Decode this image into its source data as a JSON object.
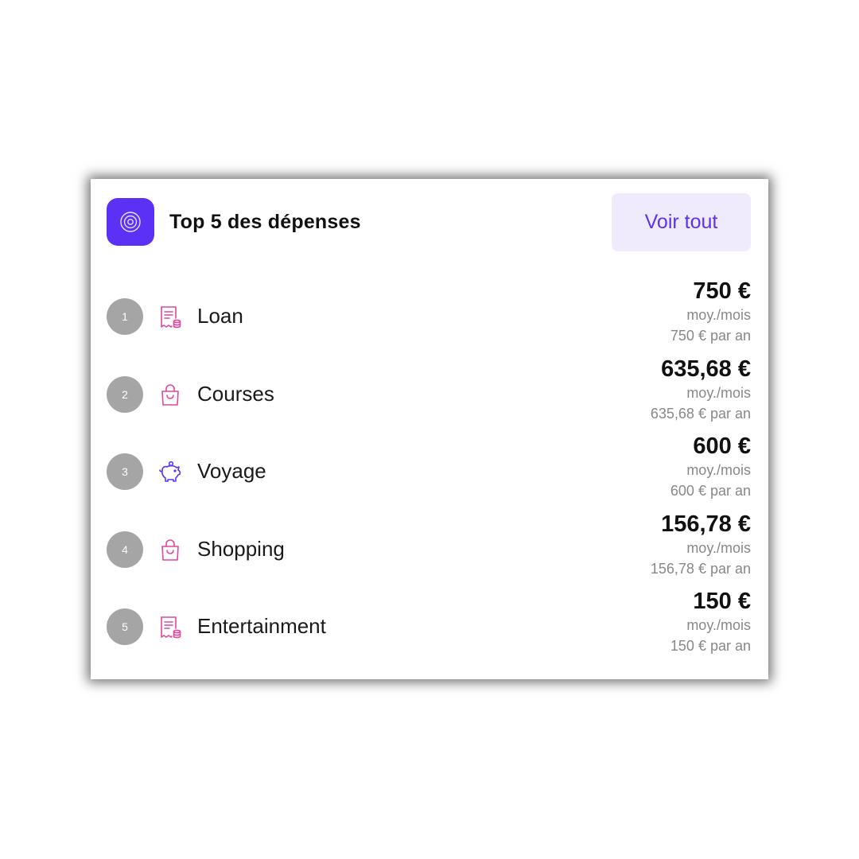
{
  "header": {
    "title": "Top 5 des dépenses",
    "icon": "target-icon",
    "see_all_label": "Voir tout",
    "accent_color": "#5b32f5"
  },
  "items": [
    {
      "rank": "1",
      "label": "Loan",
      "icon": "receipt-icon",
      "icon_color": "#e0479e",
      "amount": "750 €",
      "per_month": "moy./mois",
      "per_year": "750 € par an"
    },
    {
      "rank": "2",
      "label": "Courses",
      "icon": "shopping-bag-icon",
      "icon_color": "#e0479e",
      "amount": "635,68 €",
      "per_month": "moy./mois",
      "per_year": "635,68 € par an"
    },
    {
      "rank": "3",
      "label": "Voyage",
      "icon": "piggy-bank-icon",
      "icon_color": "#5b32f5",
      "amount": "600 €",
      "per_month": "moy./mois",
      "per_year": "600 € par an"
    },
    {
      "rank": "4",
      "label": "Shopping",
      "icon": "shopping-bag-icon",
      "icon_color": "#e0479e",
      "amount": "156,78 €",
      "per_month": "moy./mois",
      "per_year": "156,78 € par an"
    },
    {
      "rank": "5",
      "label": "Entertainment",
      "icon": "receipt-icon",
      "icon_color": "#e0479e",
      "amount": "150 €",
      "per_month": "moy./mois",
      "per_year": "150 € par an"
    }
  ]
}
